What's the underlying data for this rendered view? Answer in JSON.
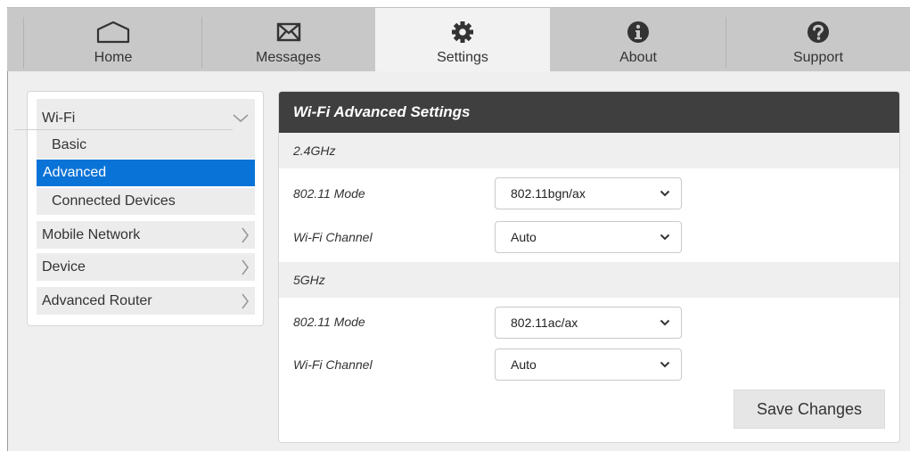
{
  "nav": {
    "tabs": [
      {
        "label": "Home",
        "icon": "home-icon",
        "active": false
      },
      {
        "label": "Messages",
        "icon": "envelope-icon",
        "active": false
      },
      {
        "label": "Settings",
        "icon": "gear-icon",
        "active": true
      },
      {
        "label": "About",
        "icon": "info-icon",
        "active": false
      },
      {
        "label": "Support",
        "icon": "question-icon",
        "active": false
      }
    ]
  },
  "sidebar": {
    "wifi": {
      "label": "Wi-Fi",
      "expanded": true,
      "items": [
        {
          "label": "Basic",
          "active": false
        },
        {
          "label": "Advanced",
          "active": true
        },
        {
          "label": "Connected Devices",
          "active": false
        }
      ]
    },
    "groups": [
      {
        "label": "Mobile Network"
      },
      {
        "label": "Device"
      },
      {
        "label": "Advanced Router"
      }
    ]
  },
  "panel": {
    "title": "Wi-Fi Advanced Settings",
    "band24": {
      "heading": "2.4GHz",
      "mode_label": "802.11 Mode",
      "mode_value": "802.11bgn/ax",
      "channel_label": "Wi-Fi Channel",
      "channel_value": "Auto"
    },
    "band5": {
      "heading": "5GHz",
      "mode_label": "802.11 Mode",
      "mode_value": "802.11ac/ax",
      "channel_label": "Wi-Fi Channel",
      "channel_value": "Auto"
    },
    "save_label": "Save Changes"
  },
  "colors": {
    "nav_bg": "#c8c8c8",
    "nav_active_bg": "#f2f2f2",
    "accent": "#0a73d7",
    "panel_header_bg": "#3f3f3f"
  }
}
